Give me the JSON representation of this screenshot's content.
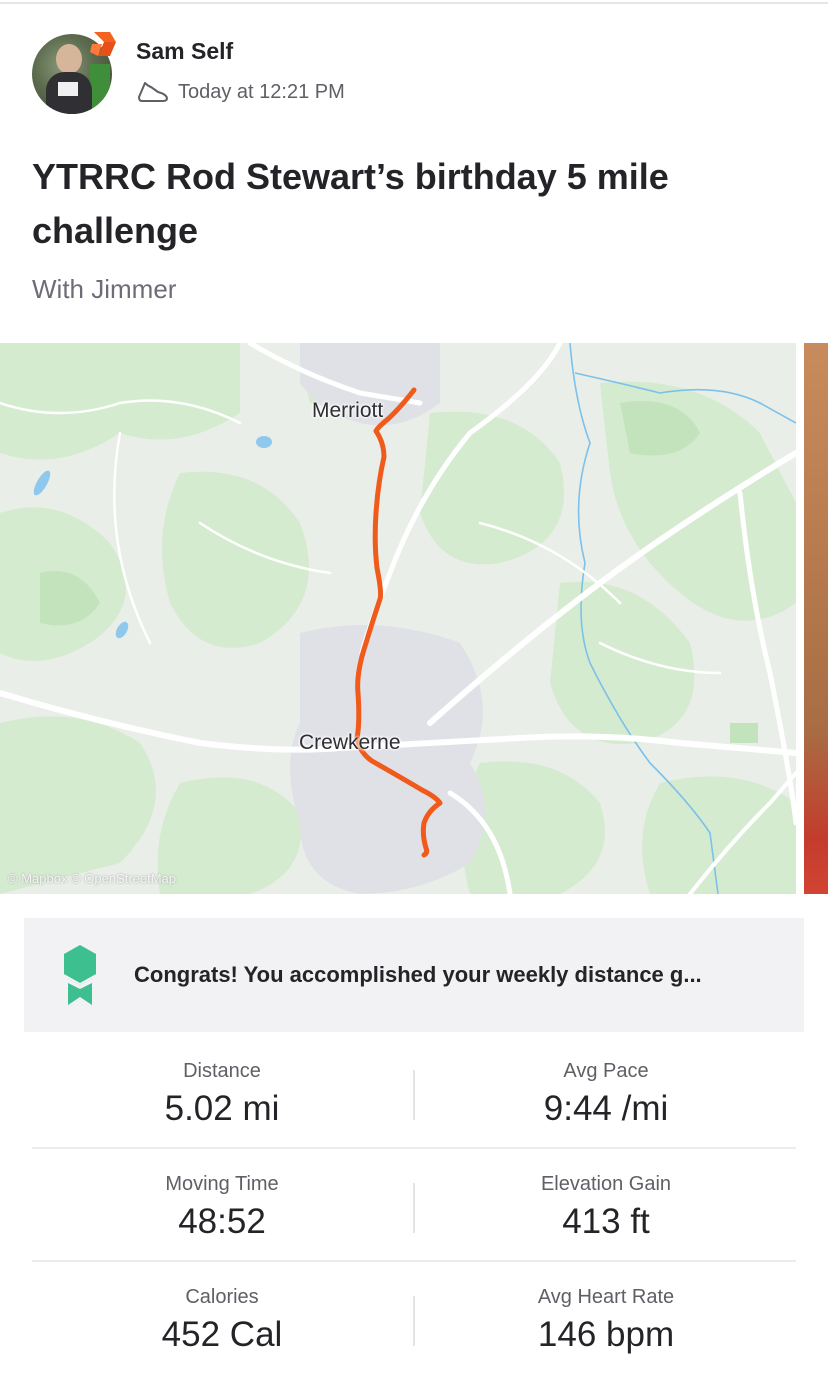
{
  "header": {
    "user_name": "Sam Self",
    "timestamp": "Today at 12:21 PM",
    "activity_icon": "shoe-icon",
    "subscriber_badge": "subscriber-chevron-icon"
  },
  "activity": {
    "title": "YTRRC Rod Stewart’s birthday 5 mile challenge",
    "with": "With Jimmer"
  },
  "map": {
    "town_top": "Merriott",
    "town_bottom": "Crewkerne",
    "attribution": "© Mapbox © OpenStreetMap",
    "route_color": "#f05a1a"
  },
  "congrats": {
    "text": "Congrats! You accomplished your weekly distance g...",
    "icon": "award-ribbon-icon",
    "icon_color": "#3dbf8f"
  },
  "stats": [
    {
      "left": {
        "label": "Distance",
        "value": "5.02 mi"
      },
      "right": {
        "label": "Avg Pace",
        "value": "9:44 /mi"
      }
    },
    {
      "left": {
        "label": "Moving Time",
        "value": "48:52"
      },
      "right": {
        "label": "Elevation Gain",
        "value": "413 ft"
      }
    },
    {
      "left": {
        "label": "Calories",
        "value": "452 Cal"
      },
      "right": {
        "label": "Avg Heart Rate",
        "value": "146 bpm"
      }
    }
  ]
}
